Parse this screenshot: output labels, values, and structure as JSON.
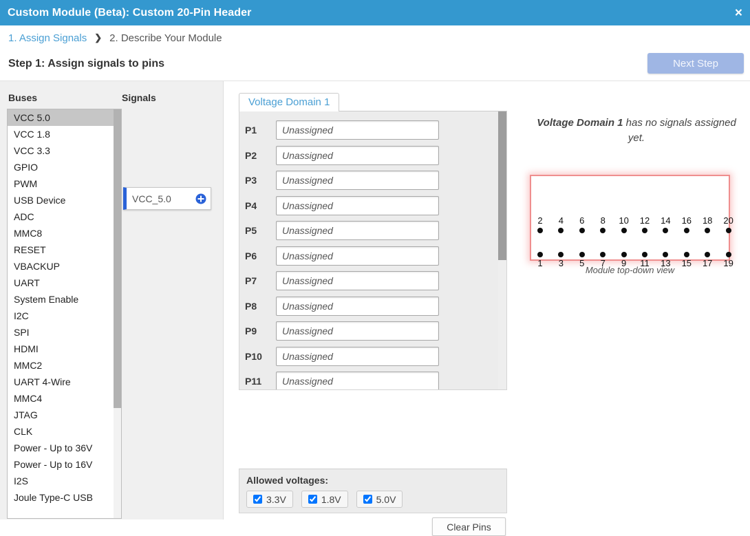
{
  "window": {
    "title": "Custom Module (Beta): Custom 20-Pin Header",
    "close_label": "×",
    "accent_color": "#3498cf"
  },
  "breadcrumb": {
    "step1": "1. Assign Signals",
    "separator": "❯",
    "step2": "2. Describe Your Module"
  },
  "step_header": {
    "title": "Step 1: Assign signals to pins",
    "next_button": "Next Step"
  },
  "buses": {
    "heading": "Buses",
    "selected": "VCC 5.0",
    "items": [
      "VCC 5.0",
      "VCC 1.8",
      "VCC 3.3",
      "GPIO",
      "PWM",
      "USB Device",
      "ADC",
      "MMC8",
      "RESET",
      "VBACKUP",
      "UART",
      "System Enable",
      "I2C",
      "SPI",
      "HDMI",
      "MMC2",
      "UART 4-Wire",
      "MMC4",
      "JTAG",
      "CLK",
      "Power - Up to 36V",
      "Power - Up to 16V",
      "I2S",
      "Joule Type-C USB"
    ]
  },
  "signals": {
    "heading": "Signals",
    "items": [
      {
        "name": "VCC_5.0",
        "add_icon": "plus-circle-icon",
        "accent_color": "#2a62d8"
      }
    ]
  },
  "pin_panel": {
    "tabs": [
      {
        "label": "Voltage Domain 1",
        "active": true
      }
    ],
    "placeholder": "Unassigned",
    "pins": [
      {
        "label": "P1",
        "value": ""
      },
      {
        "label": "P2",
        "value": ""
      },
      {
        "label": "P3",
        "value": ""
      },
      {
        "label": "P4",
        "value": ""
      },
      {
        "label": "P5",
        "value": ""
      },
      {
        "label": "P6",
        "value": ""
      },
      {
        "label": "P7",
        "value": ""
      },
      {
        "label": "P8",
        "value": ""
      },
      {
        "label": "P9",
        "value": ""
      },
      {
        "label": "P10",
        "value": ""
      },
      {
        "label": "P11",
        "value": ""
      }
    ],
    "allowed_voltages": {
      "title": "Allowed voltages:",
      "options": [
        {
          "label": "3.3V",
          "checked": true
        },
        {
          "label": "1.8V",
          "checked": true
        },
        {
          "label": "5.0V",
          "checked": true
        }
      ]
    },
    "clear_button": "Clear Pins"
  },
  "preview": {
    "message_strong": "Voltage Domain 1",
    "message_rest": " has no signals assigned yet.",
    "caption": "Module top-down view",
    "outline_color": "#ef8e8e",
    "top_row_pins": [
      2,
      4,
      6,
      8,
      10,
      12,
      14,
      16,
      18,
      20
    ],
    "bottom_row_pins": [
      1,
      3,
      5,
      7,
      9,
      11,
      13,
      15,
      17,
      19
    ]
  }
}
